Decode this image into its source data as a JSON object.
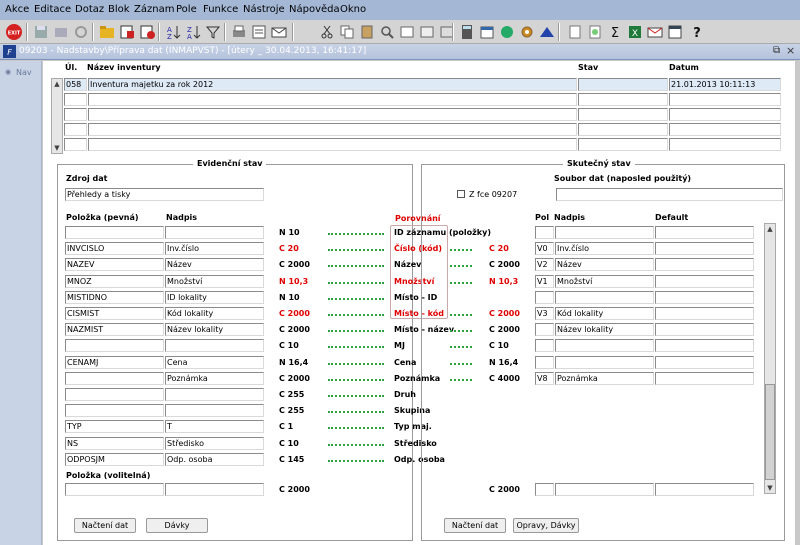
{
  "menu": [
    "Akce",
    "Editace",
    "Dotaz",
    "Blok",
    "Záznam",
    "Pole",
    "Funkce",
    "Nástroje",
    "Nápověda",
    "Okno"
  ],
  "window": {
    "title": "09203 - Nadstavby\\Příprava dat (INMAPVST) - [útery _ 30.04.2013, 16:41:17]",
    "side_tab": "Nav"
  },
  "inventory": {
    "headers": {
      "ul": "Úl.",
      "name": "Název inventury",
      "state": "Stav",
      "date": "Datum"
    },
    "rows": [
      {
        "ul": "058",
        "name": "Inventura majetku za rok 2012",
        "state": "",
        "date": "21.01.2013 10:11:13"
      },
      {
        "ul": "",
        "name": "",
        "state": "",
        "date": ""
      },
      {
        "ul": "",
        "name": "",
        "state": "",
        "date": ""
      },
      {
        "ul": "",
        "name": "",
        "state": "",
        "date": ""
      },
      {
        "ul": "",
        "name": "",
        "state": "",
        "date": ""
      }
    ]
  },
  "evid": {
    "title": "Evidenční stav",
    "source_label": "Zdroj dat",
    "source_value": "Přehledy a tisky",
    "col_item": "Položka  (pevná)",
    "col_caption": "Nadpis",
    "rows": [
      {
        "item": "",
        "caption": ""
      },
      {
        "item": "INVCISLO",
        "caption": "Inv.číslo"
      },
      {
        "item": "NAZEV",
        "caption": "Název"
      },
      {
        "item": "MNOZ",
        "caption": "Množství"
      },
      {
        "item": "MISTIDNO",
        "caption": "ID lokality"
      },
      {
        "item": "CISMIST",
        "caption": "Kód lokality"
      },
      {
        "item": "NAZMIST",
        "caption": "Název lokality"
      },
      {
        "item": "",
        "caption": ""
      },
      {
        "item": "CENAMJ",
        "caption": "Cena"
      },
      {
        "item": "",
        "caption": "Poznámka"
      },
      {
        "item": "",
        "caption": ""
      },
      {
        "item": "",
        "caption": ""
      },
      {
        "item": "TYP",
        "caption": "T"
      },
      {
        "item": "NS",
        "caption": "Středisko"
      },
      {
        "item": "ODPOSJM",
        "caption": "Odp. osoba"
      }
    ],
    "optional_label": "Položka  (volitelná)",
    "optional_type": "C 2000",
    "btn_load": "Načtení dat",
    "btn_batch": "Dávky"
  },
  "compare": {
    "title": "Porovnání",
    "rows": [
      {
        "ltype": "N 10",
        "name": "ID záznamu (položky)",
        "rtype": "",
        "red": false
      },
      {
        "ltype": "C 20",
        "name": "Číslo (kód)",
        "rtype": "C 20",
        "red": true
      },
      {
        "ltype": "C 2000",
        "name": "Název",
        "rtype": "C 2000",
        "red": false
      },
      {
        "ltype": "N 10,3",
        "name": "Množství",
        "rtype": "N 10,3",
        "red": true
      },
      {
        "ltype": "N 10",
        "name": "Místo - ID",
        "rtype": "",
        "red": false
      },
      {
        "ltype": "C 2000",
        "name": "Místo - kód",
        "rtype": "C 2000",
        "red": true
      },
      {
        "ltype": "C 2000",
        "name": "Místo - název",
        "rtype": "C 2000",
        "red": false
      },
      {
        "ltype": "C 10",
        "name": "MJ",
        "rtype": "C 10",
        "red": false
      },
      {
        "ltype": "N 16,4",
        "name": "Cena",
        "rtype": "N 16,4",
        "red": false
      },
      {
        "ltype": "C 2000",
        "name": "Poznámka",
        "rtype": "C 4000",
        "red": false
      },
      {
        "ltype": "C 255",
        "name": "Druh",
        "rtype": "",
        "red": false
      },
      {
        "ltype": "C 255",
        "name": "Skupina",
        "rtype": "",
        "red": false
      },
      {
        "ltype": "C 1",
        "name": "Typ maj.",
        "rtype": "",
        "red": false
      },
      {
        "ltype": "C 10",
        "name": "Středisko",
        "rtype": "",
        "red": false
      },
      {
        "ltype": "C 145",
        "name": "Odp. osoba",
        "rtype": "",
        "red": false
      }
    ]
  },
  "actual": {
    "title": "Skutečný stav",
    "file_label": "Soubor dat (naposled použitý)",
    "file_value": "",
    "chk_label": "Z fce 09207",
    "col_pol": "Pol",
    "col_caption": "Nadpis",
    "col_default": "Default",
    "rows": [
      {
        "pol": "",
        "caption": "",
        "default": ""
      },
      {
        "pol": "V0",
        "caption": "Inv.číslo",
        "default": ""
      },
      {
        "pol": "V2",
        "caption": "Název",
        "default": ""
      },
      {
        "pol": "V1",
        "caption": "Množství",
        "default": ""
      },
      {
        "pol": "",
        "caption": "",
        "default": ""
      },
      {
        "pol": "V3",
        "caption": "Kód lokality",
        "default": ""
      },
      {
        "pol": "",
        "caption": "Název lokality",
        "default": ""
      },
      {
        "pol": "",
        "caption": "",
        "default": ""
      },
      {
        "pol": "",
        "caption": "",
        "default": ""
      },
      {
        "pol": "V8",
        "caption": "Poznámka",
        "default": ""
      }
    ],
    "optional_type": "C 2000",
    "btn_load": "Načtení dat",
    "btn_fix": "Opravy, Dávky"
  },
  "colors": {
    "menubar": "#a4b8d6",
    "title_bar": "#b4c2dc",
    "selected_row": "#dfeaf7",
    "red_text": "#e00000",
    "dots": "#2ca33c"
  }
}
